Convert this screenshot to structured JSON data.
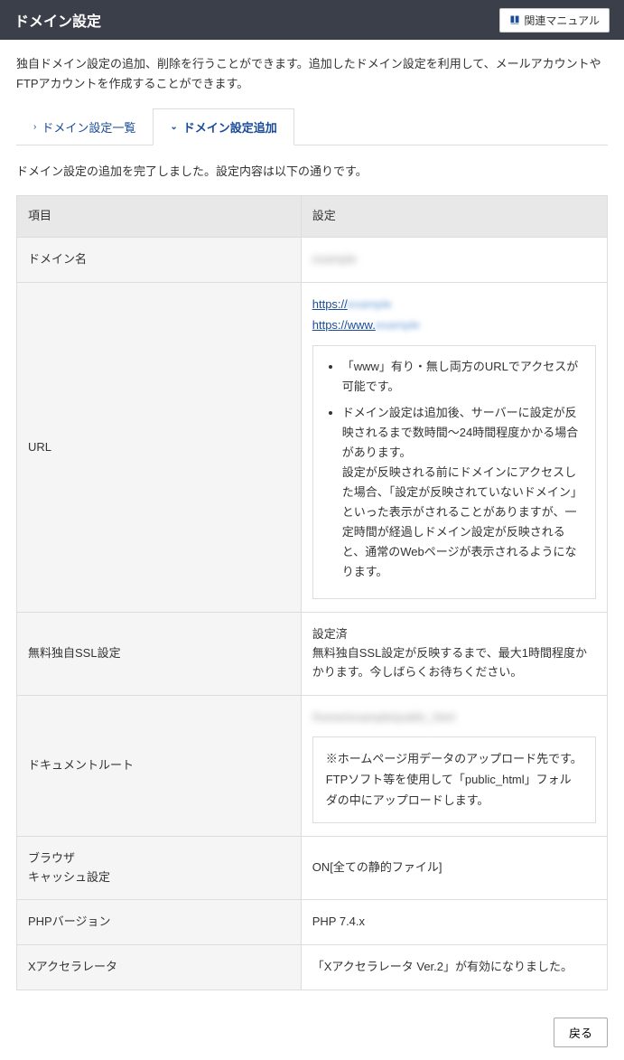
{
  "header": {
    "title": "ドメイン設定",
    "manual_label": "関連マニュアル"
  },
  "description": "独自ドメイン設定の追加、削除を行うことができます。追加したドメイン設定を利用して、メールアカウントやFTPアカウントを作成することができます。",
  "tabs": {
    "list": "ドメイン設定一覧",
    "add": "ドメイン設定追加"
  },
  "status_msg": "ドメイン設定の追加を完了しました。設定内容は以下の通りです。",
  "table": {
    "header": {
      "item": "項目",
      "setting": "設定"
    },
    "domain": {
      "label": "ドメイン名",
      "value": "example"
    },
    "url": {
      "label": "URL",
      "link1_prefix": "https://",
      "link1_suffix": "example",
      "link2_prefix": "https://www.",
      "link2_suffix": "example",
      "bullet1": "「www」有り・無し両方のURLでアクセスが可能です。",
      "bullet2": "ドメイン設定は追加後、サーバーに設定が反映されるまで数時間～24時間程度かかる場合があります。",
      "note": "設定が反映される前にドメインにアクセスした場合、「設定が反映されていないドメイン」といった表示がされることがありますが、一定時間が経過しドメイン設定が反映されると、通常のWebページが表示されるようになります。"
    },
    "ssl": {
      "label": "無料独自SSL設定",
      "status": "設定済",
      "note": "無料独自SSL設定が反映するまで、最大1時間程度かかります。今しばらくお待ちください。"
    },
    "docroot": {
      "label": "ドキュメントルート",
      "path": "/home/example/public_html",
      "line1": "※ホームページ用データのアップロード先です。",
      "line2": "FTPソフト等を使用して「public_html」フォルダの中にアップロードします。"
    },
    "cache": {
      "label1": "ブラウザ",
      "label2": "キャッシュ設定",
      "value": "ON[全ての静的ファイル]"
    },
    "php": {
      "label": "PHPバージョン",
      "value": "PHP 7.4.x"
    },
    "xaccel": {
      "label": "Xアクセラレータ",
      "value": "「Xアクセラレータ Ver.2」が有効になりました。"
    }
  },
  "buttons": {
    "back": "戻る"
  }
}
